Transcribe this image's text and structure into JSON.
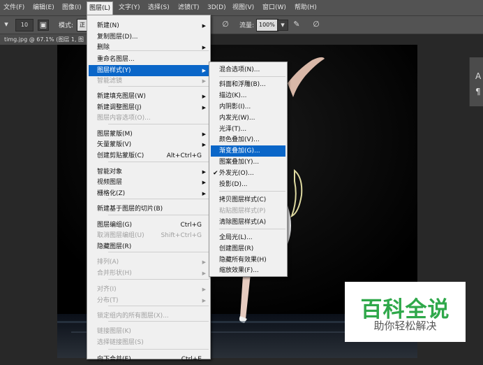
{
  "menubar": {
    "items": [
      "文件(F)",
      "编辑(E)",
      "图像(I)",
      "图层(L)",
      "文字(Y)",
      "选择(S)",
      "滤镜(T)",
      "3D(D)",
      "视图(V)",
      "窗口(W)",
      "帮助(H)"
    ]
  },
  "options": {
    "brush_size": "10",
    "mode_label": "模式:",
    "mode_value": "正",
    "flow_label": "流量:",
    "flow_value": "100%"
  },
  "document": {
    "tab": "timg.jpg @ 67.1% (图层 1, 图"
  },
  "right_panel": {
    "glyph1": "A",
    "glyph2": "¶"
  },
  "layer_menu": {
    "items": [
      {
        "label": "新建(N)",
        "arrow": true
      },
      {
        "label": "复制图层(D)..."
      },
      {
        "label": "删除",
        "arrow": true
      },
      {
        "label": "重命名图层..."
      },
      {
        "label": "图层样式(Y)",
        "arrow": true,
        "highlight": true
      },
      {
        "label": "智能滤镜",
        "disabled": true,
        "arrow": true
      },
      {
        "label": "新建填充图层(W)",
        "arrow": true
      },
      {
        "label": "新建调整图层(J)",
        "arrow": true
      },
      {
        "label": "图层内容选项(O)...",
        "disabled": true
      },
      {
        "label": "图层蒙版(M)",
        "arrow": true
      },
      {
        "label": "矢量蒙版(V)",
        "arrow": true
      },
      {
        "label": "创建剪贴蒙版(C)",
        "shortcut": "Alt+Ctrl+G"
      },
      {
        "label": "智能对象",
        "arrow": true
      },
      {
        "label": "视频图层",
        "arrow": true
      },
      {
        "label": "栅格化(Z)",
        "arrow": true
      },
      {
        "label": "新建基于图层的切片(B)"
      },
      {
        "label": "图层编组(G)",
        "shortcut": "Ctrl+G"
      },
      {
        "label": "取消图层编组(U)",
        "shortcut": "Shift+Ctrl+G",
        "disabled": true
      },
      {
        "label": "隐藏图层(R)"
      },
      {
        "label": "排列(A)",
        "arrow": true,
        "disabled": true
      },
      {
        "label": "合并形状(H)",
        "arrow": true,
        "disabled": true
      },
      {
        "label": "对齐(I)",
        "arrow": true,
        "disabled": true
      },
      {
        "label": "分布(T)",
        "arrow": true,
        "disabled": true
      },
      {
        "label": "锁定组内的所有图层(X)...",
        "disabled": true
      },
      {
        "label": "链接图层(K)",
        "disabled": true
      },
      {
        "label": "选择链接图层(S)",
        "disabled": true
      },
      {
        "label": "向下合并(E)",
        "shortcut": "Ctrl+E"
      }
    ]
  },
  "style_submenu": {
    "items": [
      {
        "label": "混合选项(N)..."
      },
      {
        "label": "斜面和浮雕(B)..."
      },
      {
        "label": "描边(K)..."
      },
      {
        "label": "内阴影(I)..."
      },
      {
        "label": "内发光(W)..."
      },
      {
        "label": "光泽(T)..."
      },
      {
        "label": "颜色叠加(V)..."
      },
      {
        "label": "渐变叠加(G)...",
        "highlight": true
      },
      {
        "label": "图案叠加(Y)..."
      },
      {
        "label": "外发光(O)...",
        "checked": true
      },
      {
        "label": "投影(D)..."
      },
      {
        "label": "拷贝图层样式(C)"
      },
      {
        "label": "粘贴图层样式(P)",
        "disabled": true
      },
      {
        "label": "清除图层样式(A)"
      },
      {
        "label": "全局光(L)..."
      },
      {
        "label": "创建图层(R)"
      },
      {
        "label": "隐藏所有效果(H)"
      },
      {
        "label": "缩放效果(F)..."
      }
    ]
  },
  "watermark": {
    "title": "百科全说",
    "subtitle": "助你轻松解决"
  },
  "colors": {
    "highlight": "#0a66c8",
    "logo_green": "#2fa84a"
  }
}
